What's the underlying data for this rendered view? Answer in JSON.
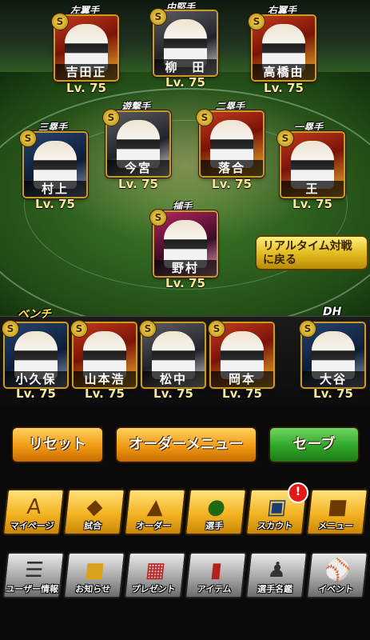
{
  "lineup": {
    "left_field": {
      "position": "左翼手",
      "name": "吉田正",
      "level": "Lv. 75"
    },
    "center_field": {
      "position": "中堅手",
      "name": "柳　田",
      "level": "Lv. 75"
    },
    "right_field": {
      "position": "右翼手",
      "name": "高橋由",
      "level": "Lv. 75"
    },
    "shortstop": {
      "position": "遊撃手",
      "name": "今宮",
      "level": "Lv. 75"
    },
    "second_base": {
      "position": "二塁手",
      "name": "落合",
      "level": "Lv. 75"
    },
    "third_base": {
      "position": "三塁手",
      "name": "村上",
      "level": "Lv. 75"
    },
    "first_base": {
      "position": "一塁手",
      "name": "王",
      "level": "Lv. 75"
    },
    "catcher": {
      "position": "捕手",
      "name": "野村",
      "level": "Lv. 75"
    }
  },
  "bench": {
    "label": "ベンチ",
    "players": [
      {
        "name": "小久保",
        "level": "Lv. 75"
      },
      {
        "name": "山本浩",
        "level": "Lv. 75"
      },
      {
        "name": "松中",
        "level": "Lv. 75"
      },
      {
        "name": "岡本",
        "level": "Lv. 75"
      }
    ]
  },
  "dh": {
    "label": "DH",
    "name": "大谷",
    "level": "Lv. 75"
  },
  "badge_letter": "S",
  "realtime_button": "リアルタイム対戦に戻る",
  "controls": {
    "reset": "リセット",
    "order_menu": "オーダーメニュー",
    "save": "セーブ"
  },
  "main_menu": [
    {
      "label": "マイページ",
      "icon": "mypage-icon"
    },
    {
      "label": "試合",
      "icon": "match-icon"
    },
    {
      "label": "オーダー",
      "icon": "order-icon"
    },
    {
      "label": "選手",
      "icon": "player-icon"
    },
    {
      "label": "スカウト",
      "icon": "scout-icon"
    },
    {
      "label": "メニュー",
      "icon": "menu-icon"
    }
  ],
  "scout_alert": "!",
  "sub_menu": [
    {
      "label": "ユーザー情報",
      "icon": "user-info-icon"
    },
    {
      "label": "お知らせ",
      "icon": "news-icon"
    },
    {
      "label": "プレゼント",
      "icon": "present-icon"
    },
    {
      "label": "アイテム",
      "icon": "item-icon"
    },
    {
      "label": "選手名鑑",
      "icon": "directory-icon"
    },
    {
      "label": "イベント",
      "icon": "event-icon"
    }
  ],
  "colors": {
    "gold": "#f4b321",
    "green": "#2fa52a",
    "alert": "#e01919"
  }
}
